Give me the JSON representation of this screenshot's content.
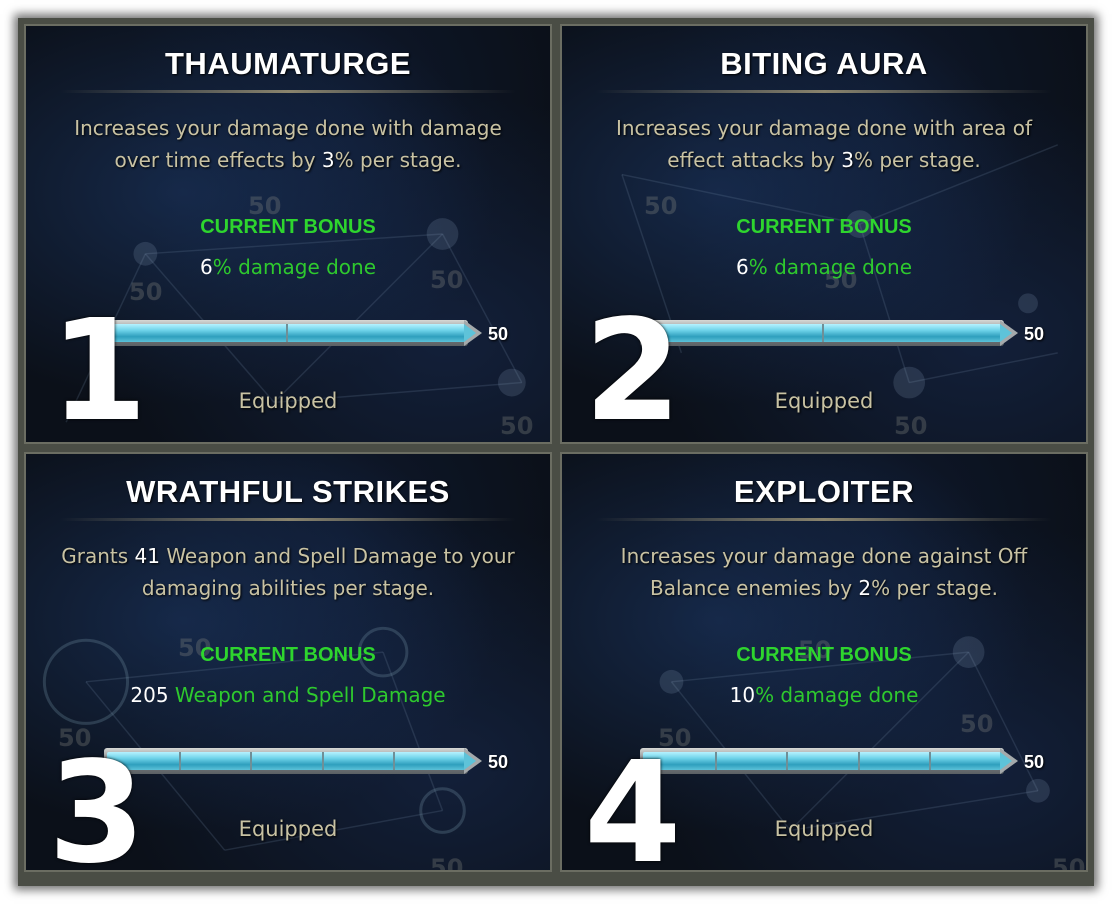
{
  "panels": [
    {
      "number": "1",
      "title": "THAUMATURGE",
      "description": {
        "before": "Increases your damage done with damage over time effects by ",
        "highlight": "3",
        "after": "% per stage."
      },
      "current_bonus_label": "CURRENT BONUS",
      "current_bonus": {
        "amount": "6",
        "text": "% damage done"
      },
      "progress": 1.0,
      "segments": 2,
      "max_label": "50",
      "status": "Equipped",
      "background_numbers": [
        "50",
        "50",
        "50",
        "50"
      ]
    },
    {
      "number": "2",
      "title": "BITING AURA",
      "description": {
        "before": "Increases your damage done with area of effect attacks by ",
        "highlight": "3",
        "after": "% per stage."
      },
      "current_bonus_label": "CURRENT BONUS",
      "current_bonus": {
        "amount": "6",
        "text": "% damage done"
      },
      "progress": 1.0,
      "segments": 2,
      "max_label": "50",
      "status": "Equipped",
      "background_numbers": [
        "50",
        "50",
        "50"
      ]
    },
    {
      "number": "3",
      "title": "WRATHFUL STRIKES",
      "description": {
        "before": "Grants ",
        "highlight": "41",
        "after": " Weapon and Spell Damage to your damaging abilities per stage."
      },
      "current_bonus_label": "CURRENT BONUS",
      "current_bonus": {
        "amount": "205",
        "text": " Weapon and Spell Damage"
      },
      "progress": 1.0,
      "segments": 5,
      "max_label": "50",
      "status": "Equipped",
      "background_numbers": [
        "50",
        "50",
        "50"
      ]
    },
    {
      "number": "4",
      "title": "EXPLOITER",
      "description": {
        "before": "Increases your damage done against Off Balance enemies by ",
        "highlight": "2",
        "after": "% per stage."
      },
      "current_bonus_label": "CURRENT BONUS",
      "current_bonus": {
        "amount": "10",
        "text": "% damage done"
      },
      "progress": 1.0,
      "segments": 5,
      "max_label": "50",
      "status": "Equipped",
      "background_numbers": [
        "50",
        "50",
        "50",
        "50"
      ]
    }
  ],
  "colors": {
    "bonus_green": "#2ed52e",
    "description_text": "#c8c2a3",
    "bar_fill": "#6ed3e9"
  }
}
